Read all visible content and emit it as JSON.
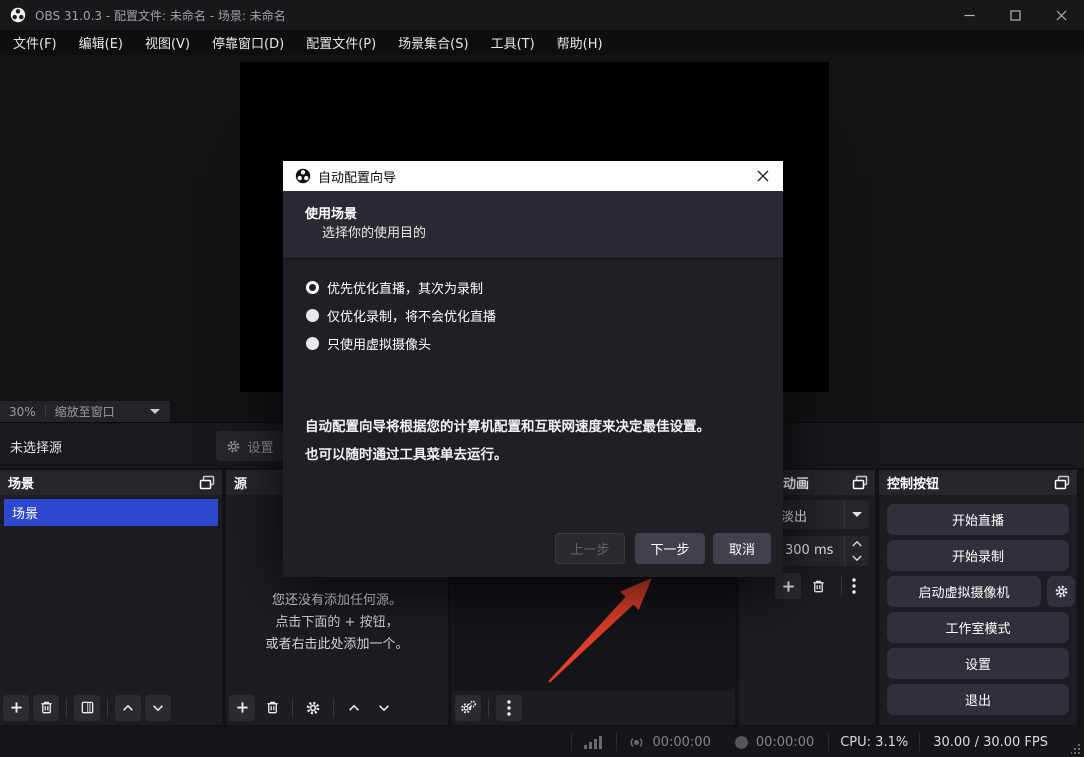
{
  "colors": {
    "accent_blue": "#2e48cf",
    "arrow_red": "#e2402b",
    "dialog_titlebar": "#ffffff"
  },
  "titlebar": {
    "title": "OBS 31.0.3 - 配置文件: 未命名 - 场景: 未命名"
  },
  "menu": {
    "items": [
      "文件(F)",
      "编辑(E)",
      "视图(V)",
      "停靠窗口(D)",
      "配置文件(P)",
      "场景集合(S)",
      "工具(T)",
      "帮助(H)"
    ]
  },
  "preview": {
    "zoom_level": "30%",
    "zoom_mode": "缩放至窗口"
  },
  "source_toolbar": {
    "no_source": "未选择源",
    "properties": "设置"
  },
  "dialog": {
    "title": "自动配置向导",
    "heading": "使用场景",
    "subheading": "选择你的使用目的",
    "options": [
      {
        "label": "优先优化直播，其次为录制",
        "selected": true
      },
      {
        "label": "仅优化录制，将不会优化直播",
        "selected": false
      },
      {
        "label": "只使用虚拟摄像头",
        "selected": false
      }
    ],
    "description_line1": "自动配置向导将根据您的计算机配置和互联网速度来决定最佳设置。",
    "description_line2": "也可以随时通过工具菜单去运行。",
    "back": "上一步",
    "next": "下一步",
    "cancel": "取消"
  },
  "docks": {
    "scenes": {
      "title": "场景",
      "items": [
        "场景"
      ]
    },
    "sources": {
      "title": "源",
      "empty_line1": "您还没有添加任何源。",
      "empty_line2": "点击下面的 + 按钮，",
      "empty_line3": "或者右击此处添加一个。"
    },
    "transitions": {
      "title_visible": "动画",
      "transition": "淡出",
      "duration": "300 ms"
    },
    "controls": {
      "title": "控制按钮",
      "buttons": [
        "开始直播",
        "开始录制",
        "启动虚拟摄像机",
        "工作室模式",
        "设置",
        "退出"
      ]
    }
  },
  "statusbar": {
    "stream_time": "00:00:00",
    "record_time": "00:00:00",
    "cpu": "CPU: 3.1%",
    "fps": "30.00 / 30.00 FPS"
  },
  "icons": {
    "obs-logo": "circle-with-three-dots",
    "gear": "settings-gear",
    "trash": "trash-can",
    "plus": "plus-sign",
    "popout": "overlapping-windows",
    "kebab": "vertical-dots",
    "signal": "ascending-bars",
    "stream": "broadcast-dot",
    "record": "solid-circle"
  }
}
